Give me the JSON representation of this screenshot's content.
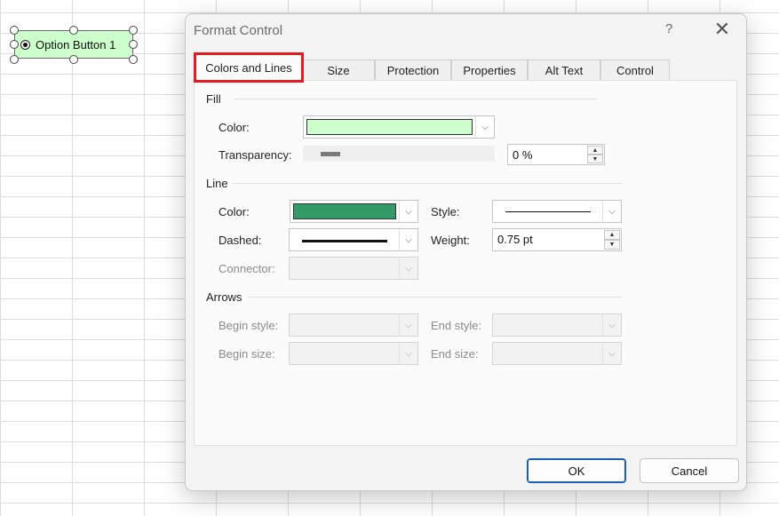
{
  "sheet": {
    "option_button_label": "Option Button 1"
  },
  "dialog": {
    "title": "Format Control",
    "help": "?",
    "close": "✕",
    "tabs": [
      {
        "label": "Colors and Lines"
      },
      {
        "label": "Size"
      },
      {
        "label": "Protection"
      },
      {
        "label": "Properties"
      },
      {
        "label": "Alt Text"
      },
      {
        "label": "Control"
      }
    ],
    "active_tab": "Colors and Lines",
    "fill": {
      "group": "Fill",
      "color_label": "Color:",
      "color_value": "#ccffcc",
      "transparency_label": "Transparency:",
      "transparency_value": "0 %"
    },
    "line": {
      "group": "Line",
      "color_label": "Color:",
      "color_value": "#339966",
      "dashed_label": "Dashed:",
      "connector_label": "Connector:",
      "style_label": "Style:",
      "weight_label": "Weight:",
      "weight_value": "0.75 pt"
    },
    "arrows": {
      "group": "Arrows",
      "begin_style_label": "Begin style:",
      "begin_size_label": "Begin size:",
      "end_style_label": "End style:",
      "end_size_label": "End size:"
    },
    "buttons": {
      "ok": "OK",
      "cancel": "Cancel"
    }
  },
  "colors": {
    "highlight": "#e31b23",
    "accent": "#1a5fb4"
  },
  "icons": {
    "dropdown": "chevron-down-icon",
    "spin_up": "spin-up-icon",
    "spin_down": "spin-down-icon",
    "close": "close-icon",
    "help": "help-icon",
    "radio": "radio-selected-icon"
  }
}
